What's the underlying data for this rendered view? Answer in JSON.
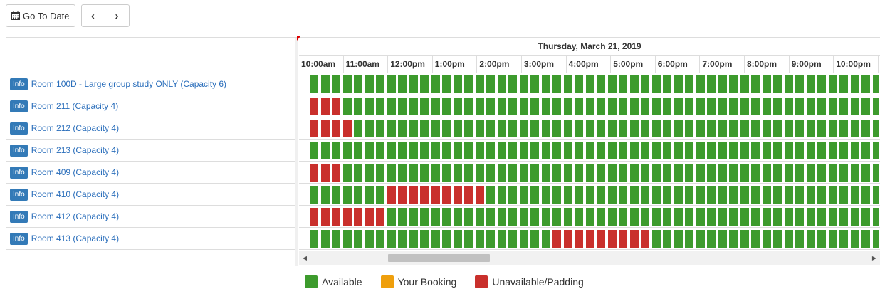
{
  "toolbar": {
    "go_to_date_label": "Go To Date",
    "go_to_date_icon": "calendar-icon",
    "prev_label": "‹",
    "next_label": "›"
  },
  "grid": {
    "date_header": "Thursday, March 21, 2019",
    "hours": [
      "10:00am",
      "11:00am",
      "12:00pm",
      "1:00pm",
      "2:00pm",
      "3:00pm",
      "4:00pm",
      "5:00pm",
      "6:00pm",
      "7:00pm",
      "8:00pm",
      "9:00pm",
      "10:00pm"
    ],
    "slots_per_row": 52,
    "info_badge": "Info",
    "rooms": [
      {
        "name": "Room 100D - Large group study ONLY (Capacity 6)",
        "unavailable": []
      },
      {
        "name": "Room 211 (Capacity 4)",
        "unavailable": [
          [
            0,
            2
          ]
        ]
      },
      {
        "name": "Room 212 (Capacity 4)",
        "unavailable": [
          [
            0,
            3
          ]
        ]
      },
      {
        "name": "Room 213 (Capacity 4)",
        "unavailable": []
      },
      {
        "name": "Room 409 (Capacity 4)",
        "unavailable": [
          [
            0,
            2
          ]
        ]
      },
      {
        "name": "Room 410 (Capacity 4)",
        "unavailable": [
          [
            7,
            15
          ]
        ]
      },
      {
        "name": "Room 412 (Capacity 4)",
        "unavailable": [
          [
            0,
            6
          ]
        ]
      },
      {
        "name": "Room 413 (Capacity 4)",
        "unavailable": [
          [
            22,
            30
          ]
        ]
      }
    ]
  },
  "legend": [
    {
      "label": "Available",
      "color": "#3d9b2d"
    },
    {
      "label": "Your Booking",
      "color": "#ef9f0c"
    },
    {
      "label": "Unavailable/Padding",
      "color": "#c9302c"
    }
  ],
  "colors": {
    "available": "#3d9b2d",
    "unavailable": "#c9302c",
    "booking": "#ef9f0c",
    "link": "#2a6ebb",
    "info_badge": "#337ab7"
  }
}
